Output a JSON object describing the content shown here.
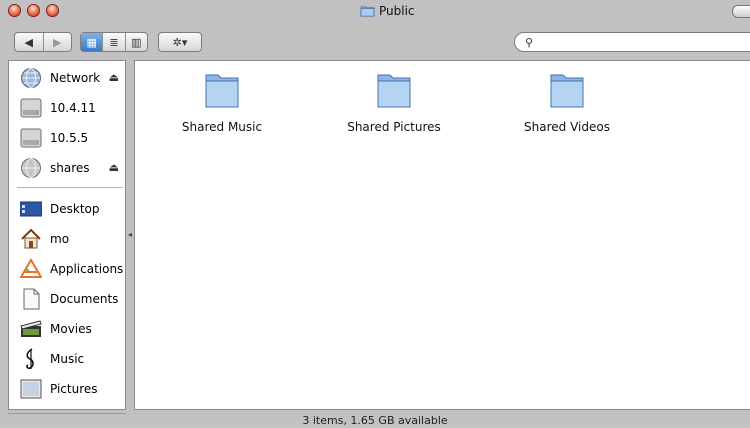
{
  "window": {
    "title": "Public"
  },
  "toolbar": {
    "back_label": "◀",
    "forward_label": "▶",
    "view_icons_label": "▦",
    "view_list_label": "≣",
    "view_columns_label": "▥",
    "action_label": "✲▾",
    "search": {
      "placeholder": "",
      "value": ""
    },
    "search_glyph": "⚲"
  },
  "sidebar": {
    "items": [
      {
        "label": "Network",
        "icon": "network-globe-icon",
        "eject": true
      },
      {
        "label": "10.4.11",
        "icon": "hard-drive-icon",
        "eject": false
      },
      {
        "label": "10.5.5",
        "icon": "hard-drive-icon",
        "eject": false
      },
      {
        "label": "shares",
        "icon": "network-share-icon",
        "eject": true
      },
      {
        "label": "Desktop",
        "icon": "desktop-icon"
      },
      {
        "label": "mo",
        "icon": "home-icon"
      },
      {
        "label": "Applications",
        "icon": "applications-icon"
      },
      {
        "label": "Documents",
        "icon": "documents-icon"
      },
      {
        "label": "Movies",
        "icon": "movies-icon"
      },
      {
        "label": "Music",
        "icon": "music-icon"
      },
      {
        "label": "Pictures",
        "icon": "pictures-icon"
      }
    ],
    "eject_glyph": "⏏"
  },
  "content": {
    "files": [
      {
        "name": "Shared Music",
        "icon": "folder-icon"
      },
      {
        "name": "Shared Pictures",
        "icon": "folder-icon"
      },
      {
        "name": "Shared Videos",
        "icon": "folder-icon"
      }
    ]
  },
  "status": {
    "text": "3 items, 1.65 GB available"
  },
  "colors": {
    "selection_blue": "#3a78c8",
    "traffic_red": "#c8361c"
  }
}
